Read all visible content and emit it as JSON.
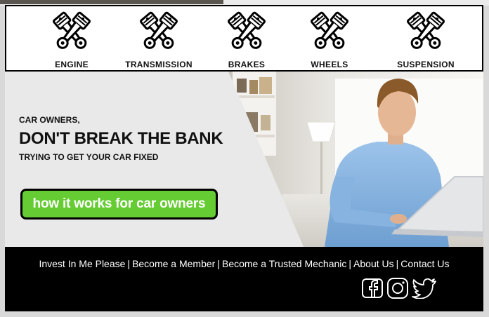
{
  "categories": [
    {
      "label": "ENGINE",
      "icon": "engine-pistons-icon"
    },
    {
      "label": "TRANSMISSION",
      "icon": "transmission-pistons-icon"
    },
    {
      "label": "BRAKES",
      "icon": "brakes-pistons-icon"
    },
    {
      "label": "WHEELS",
      "icon": "wheels-pistons-icon"
    },
    {
      "label": "SUSPENSION",
      "icon": "suspension-pistons-icon"
    }
  ],
  "hero": {
    "kicker": "CAR OWNERS,",
    "headline": "DON'T BREAK THE BANK",
    "subline": "TRYING TO GET YOUR CAR FIXED",
    "cta_label": "how it works for car owners"
  },
  "footer": {
    "links": [
      {
        "label": "Invest In Me Please"
      },
      {
        "label": "Become a Member"
      },
      {
        "label": "Become a Trusted Mechanic"
      },
      {
        "label": "About Us"
      },
      {
        "label": "Contact Us"
      }
    ],
    "separator": "|",
    "social": [
      "facebook-icon",
      "instagram-icon",
      "twitter-icon"
    ]
  },
  "colors": {
    "cta_green": "#66cc33",
    "footer_bg": "#000000",
    "hero_bg": "#e9e9e9"
  }
}
